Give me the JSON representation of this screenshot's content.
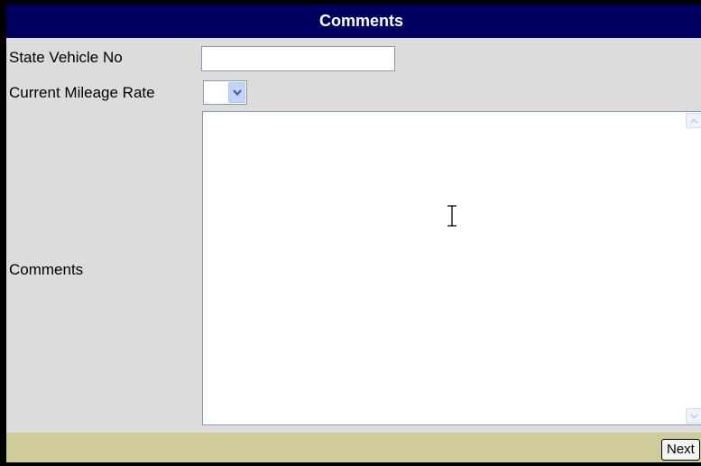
{
  "title": "Comments",
  "fields": {
    "state_vehicle_no": {
      "label": "State Vehicle No",
      "value": ""
    },
    "current_mileage_rate": {
      "label": "Current Mileage Rate",
      "selected": ""
    },
    "comments": {
      "label": "Comments",
      "value": ""
    }
  },
  "footer": {
    "next_label": "Next"
  },
  "colors": {
    "title_bg": "#000060",
    "form_bg": "#dcdcdc",
    "footer_bg": "#cfcc9a"
  },
  "icons": [
    "chevron-down-icon",
    "scroll-up-arrow-icon",
    "scroll-down-arrow-icon",
    "text-cursor-icon"
  ]
}
